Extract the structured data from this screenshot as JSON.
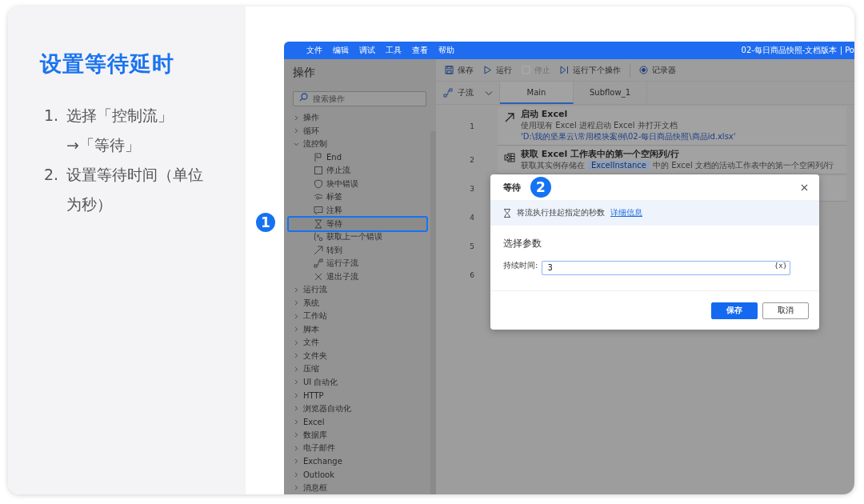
{
  "tutorial": {
    "title": "设置等待延时",
    "steps": [
      {
        "number": "1.",
        "lines": [
          "选择「控制流」",
          "→「等待」"
        ]
      },
      {
        "number": "2.",
        "lines": [
          "设置等待时间（单位",
          "为秒）"
        ]
      }
    ]
  },
  "callouts": [
    "1",
    "2"
  ],
  "app": {
    "menu": [
      "文件",
      "编辑",
      "调试",
      "工具",
      "查看",
      "帮助"
    ],
    "document_title": "02-每日商品快照-文档版本 | Po",
    "sidebar": {
      "title": "操作",
      "search": {
        "placeholder": "搜索操作"
      },
      "tree": [
        {
          "label": "操作",
          "expanded": false
        },
        {
          "label": "循环",
          "expanded": false
        },
        {
          "label": "流控制",
          "expanded": true,
          "children": [
            {
              "label": "End",
              "selected": false
            },
            {
              "label": "停止流",
              "selected": false
            },
            {
              "label": "块中错误",
              "selected": false
            },
            {
              "label": "标签",
              "selected": false
            },
            {
              "label": "注释",
              "selected": false
            },
            {
              "label": "等待",
              "selected": true
            },
            {
              "label": "获取上一个错误",
              "selected": false
            },
            {
              "label": "转到",
              "selected": false
            },
            {
              "label": "运行子流",
              "selected": false
            },
            {
              "label": "退出子流",
              "selected": false
            }
          ]
        },
        {
          "label": "运行流",
          "expanded": false
        },
        {
          "label": "系统",
          "expanded": false
        },
        {
          "label": "工作站",
          "expanded": false
        },
        {
          "label": "脚本",
          "expanded": false
        },
        {
          "label": "文件",
          "expanded": false
        },
        {
          "label": "文件夹",
          "expanded": false
        },
        {
          "label": "压缩",
          "expanded": false
        },
        {
          "label": "UI 自动化",
          "expanded": false
        },
        {
          "label": "HTTP",
          "expanded": false
        },
        {
          "label": "浏览器自动化",
          "expanded": false
        },
        {
          "label": "Excel",
          "expanded": false
        },
        {
          "label": "数据库",
          "expanded": false
        },
        {
          "label": "电子邮件",
          "expanded": false
        },
        {
          "label": "Exchange",
          "expanded": false
        },
        {
          "label": "Outlook",
          "expanded": false
        },
        {
          "label": "消息框",
          "expanded": false
        }
      ]
    },
    "toolbar": [
      {
        "label": "保存",
        "disabled": false
      },
      {
        "label": "运行",
        "disabled": false
      },
      {
        "label": "停止",
        "disabled": true
      },
      {
        "label": "运行下个操作",
        "disabled": false
      },
      {
        "label": "记录器",
        "disabled": false
      }
    ],
    "subflows_button": "子流",
    "tabs": [
      {
        "label": "Main",
        "selected": true
      },
      {
        "label": "Subflow_1",
        "selected": false
      }
    ],
    "line_numbers": [
      "1",
      "2",
      "3",
      "4",
      "5",
      "6"
    ],
    "actions": [
      {
        "title": "启动 Excel",
        "description": [
          {
            "kind": "plain",
            "text": "使用现有 Excel 进程启动 Excel 并打开文档"
          },
          {
            "kind": "path",
            "text": "'D:\\我的坚果云\\常用模块案例\\02-每日商品快照\\商品id.xlsx'"
          }
        ]
      },
      {
        "title": "获取 Excel 工作表中的第一个空闲列/行",
        "description": [
          {
            "kind": "plain",
            "text": "获取其实例存储在"
          },
          {
            "kind": "variable",
            "text": "ExcelInstance"
          },
          {
            "kind": "plain",
            "text": "中的 Excel 文档的活动工作表中的第一个空闲列/行"
          }
        ]
      }
    ],
    "dialog": {
      "title": "等待",
      "info": "将流执行挂起指定的秒数",
      "link": "详细信息",
      "section": "选择参数",
      "field": {
        "label": "持续时间:",
        "value": "3",
        "variable_button": "{x}"
      },
      "buttons": [
        {
          "label": "保存",
          "primary": true
        },
        {
          "label": "取消",
          "primary": false
        }
      ]
    }
  }
}
